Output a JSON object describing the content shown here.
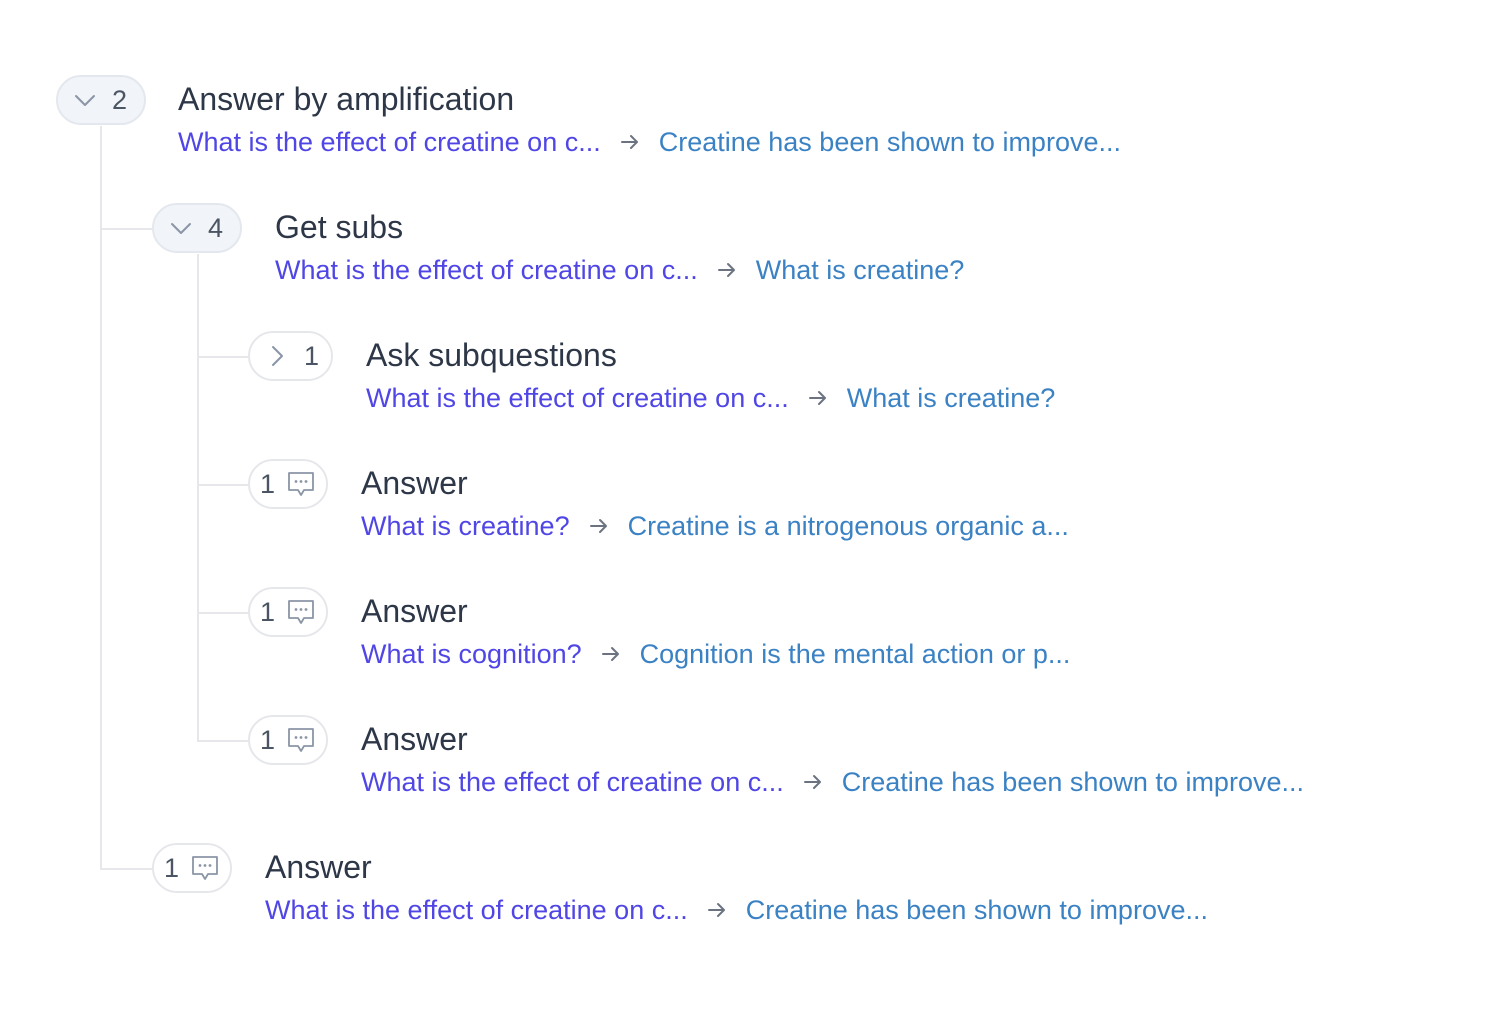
{
  "colors": {
    "question_text": "#4f46e5",
    "answer_text": "#3b82c4",
    "title_text": "#2d3748",
    "tree_line": "#e5e7eb",
    "pill_expanded_bg": "#f1f4f8"
  },
  "nodes": {
    "n1": {
      "count": "2",
      "toggle_icon": "chevron-down-icon",
      "title": "Answer by amplification",
      "question": "What is the effect of creatine on c...",
      "answer": "Creatine has been shown to improve..."
    },
    "n2": {
      "count": "4",
      "toggle_icon": "chevron-down-icon",
      "title": "Get subs",
      "question": "What is the effect of creatine on c...",
      "answer": "What is creatine?"
    },
    "n3": {
      "count": "1",
      "toggle_icon": "chevron-right-icon",
      "title": "Ask subquestions",
      "question": "What is the effect of creatine on c...",
      "answer": "What is creatine?"
    },
    "n4": {
      "count": "1",
      "toggle_icon": "message-icon",
      "title": "Answer",
      "question": "What is creatine?",
      "answer": "Creatine is a nitrogenous organic a..."
    },
    "n5": {
      "count": "1",
      "toggle_icon": "message-icon",
      "title": "Answer",
      "question": "What is cognition?",
      "answer": "Cognition is the mental action or p..."
    },
    "n6": {
      "count": "1",
      "toggle_icon": "message-icon",
      "title": "Answer",
      "question": "What is the effect of creatine on c...",
      "answer": "Creatine has been shown to improve..."
    },
    "n7": {
      "count": "1",
      "toggle_icon": "message-icon",
      "title": "Answer",
      "question": "What is the effect of creatine on c...",
      "answer": "Creatine has been shown to improve..."
    }
  }
}
